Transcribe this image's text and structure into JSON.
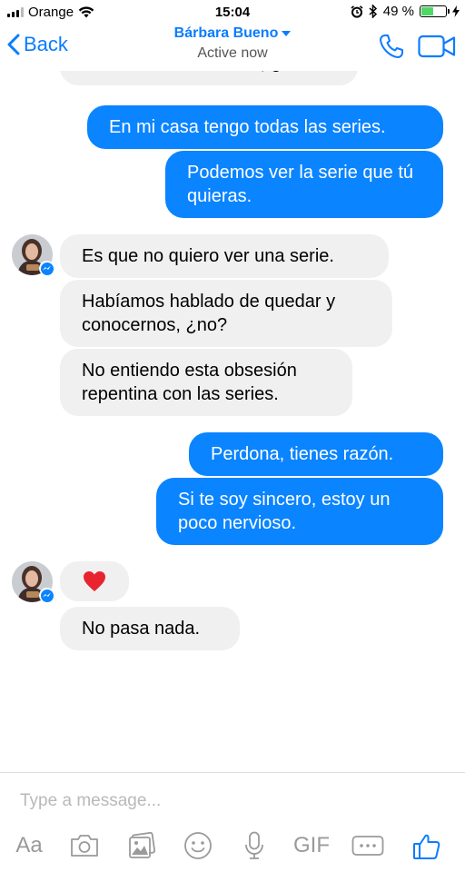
{
  "status_bar": {
    "carrier": "Orange",
    "time": "15:04",
    "battery_percent": "49 %",
    "battery_level": 0.49
  },
  "header": {
    "back_label": "Back",
    "contact_name": "Bárbara Bueno",
    "status": "Active now"
  },
  "messages": [
    {
      "side": "in",
      "text": "Ahora estás de broma, ¿no?"
    },
    {
      "side": "out",
      "text": "En mi casa tengo todas las series."
    },
    {
      "side": "out",
      "text": "Podemos ver la serie que tú quieras."
    },
    {
      "side": "in",
      "text": "Es que no quiero ver una serie."
    },
    {
      "side": "in",
      "text": "Habíamos hablado de quedar y conocernos, ¿no?"
    },
    {
      "side": "in",
      "text": "No entiendo esta obsesión repentina con las series."
    },
    {
      "side": "out",
      "text": "Perdona, tienes razón."
    },
    {
      "side": "out",
      "text": "Si te soy sincero, estoy un poco nervioso."
    },
    {
      "side": "in",
      "text": "❤️"
    },
    {
      "side": "in",
      "text": "No pasa nada."
    }
  ],
  "composer": {
    "placeholder": "Type a message...",
    "text_tool_label": "Aa",
    "gif_label": "GIF"
  },
  "colors": {
    "accent": "#0a7cff",
    "outgoing_bubble": "#0a84ff",
    "incoming_bubble": "#f0f0f0",
    "heart": "#e8242f"
  }
}
